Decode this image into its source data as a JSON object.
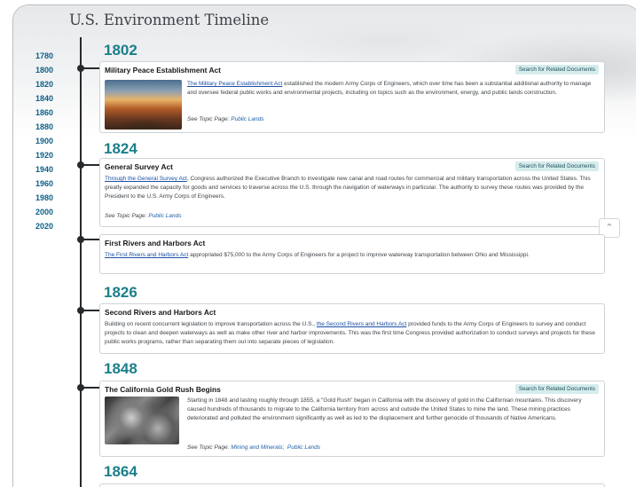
{
  "page": {
    "title": "U.S. Environment Timeline"
  },
  "year_nav": [
    "1780",
    "1800",
    "1820",
    "1840",
    "1860",
    "1880",
    "1900",
    "1920",
    "1940",
    "1960",
    "1980",
    "2000",
    "2020"
  ],
  "years": {
    "y1802": "1802",
    "y1824": "1824",
    "y1826": "1826",
    "y1848": "1848",
    "y1864": "1864"
  },
  "search_label": "Search for Related Documents",
  "topic_prefix": "See Topic Page: ",
  "events": [
    {
      "title": "Military Peace Establishment Act",
      "link": "The Military Peace Establishment Act",
      "text": " established the modern Army Corps of Engineers, which over time has been a substantial additional authority to manage and oversee federal public works and environmental projects, including on topics such as the environment, energy, and public lands construction.",
      "topic": "Public Lands"
    },
    {
      "title": "General Survey Act",
      "link": "Through the General Survey Act",
      "text": ", Congress authorized the Executive Branch to investigate new canal and road routes for commercial and military transportation across the United States. This greatly expanded the capacity for goods and services to traverse across the U.S. through the navigation of waterways in particular. The authority to survey these routes was provided by the President to the U.S. Army Corps of Engineers.",
      "topic": "Public Lands"
    },
    {
      "title": "First Rivers and Harbors Act",
      "link": "The First Rivers and Harbors Act",
      "text": " appropriated $75,000 to the Army Corps of Engineers for a project to improve waterway transportation between Ohio and Mississippi."
    },
    {
      "title": "Second Rivers and Harbors Act",
      "pre": "Building on recent concurrent legislation to improve transportation across the U.S., ",
      "link": "the Second Rivers and Harbors Act",
      "text": " provided funds to the Army Corps of Engineers to survey and conduct projects to clean and deepen waterways as well as make other river and harbor improvements. This was the first time Congress provided authorization to conduct surveys and projects for these public works programs, rather than separating them out into separate pieces of legislation."
    },
    {
      "title": "The California Gold Rush Begins",
      "text": "Starting in 1848 and lasting roughly through 1855, a \"Gold Rush\" began in California with the discovery of gold in the Californian mountains. This discovery caused hundreds of thousands to migrate to the California territory from across and outside the United States to mine the land. These mining practices deteriorated and polluted the environment significantly as well as led to the displacement and further genocide of thousands of Native Americans.",
      "topic1": "Mining and Minerals",
      "topic_sep": ";  ",
      "topic2": "Public Lands"
    }
  ]
}
